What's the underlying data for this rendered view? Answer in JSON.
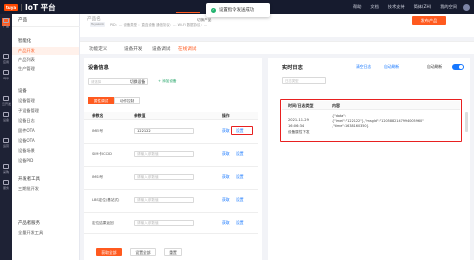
{
  "topbar": {
    "logo_text": "tuya",
    "title": "IoT 平台",
    "links": [
      "帮助",
      "文档",
      "技术支持",
      "简体(ZH)",
      "我的空间"
    ]
  },
  "toast": {
    "text": "设置指令发送成功"
  },
  "sidebar_icons": [
    {
      "label": "产品",
      "active": true
    },
    {
      "label": "应用"
    },
    {
      "label": "App"
    },
    {
      "label": "云开发"
    },
    {
      "label": "设备"
    },
    {
      "label": "运营"
    },
    {
      "label": "采购"
    },
    {
      "label": "服务"
    }
  ],
  "sidebar": {
    "header": "产品",
    "sections": [
      {
        "title": "智能化",
        "items": [
          "产品开发",
          "产品列表",
          "生产管理"
        ]
      },
      {
        "title": "设备",
        "items": [
          "设备管理",
          "子设备管理",
          "设备日志",
          "固件OTA",
          "设备OTA",
          "设备场景",
          "设备PID"
        ]
      },
      {
        "title": "开发者工具",
        "items": [
          "三期批开发"
        ]
      },
      {
        "title": "产品者服务",
        "items": [
          "全量开发工具"
        ]
      }
    ],
    "active_item": "产品开发"
  },
  "product_header": {
    "product_name": "产品名",
    "switch_label": "切换产品",
    "back_label": "TuyaLink",
    "meta": "PID：… 设备类型 ：直连设备   通信协议：…   Wi-Fi 数据协议：…",
    "publish_button": "发布产品"
  },
  "tabs": [
    "功能定义",
    "设备开发",
    "设备调试",
    "在线调试"
  ],
  "active_tab": "在线调试",
  "device_panel": {
    "title": "设备信息",
    "select_placeholder": "请选择",
    "switch_device": "切换设备",
    "add_device": "+ 添加设备",
    "subtabs": [
      "属性调试",
      "动作控制"
    ],
    "columns": [
      "参数名",
      "参数值",
      "操作"
    ],
    "rows": [
      {
        "name": "IMEI号",
        "value": "122122",
        "placeholder": false
      },
      {
        "name": "SIM卡ICCID",
        "value": "请输入参数值",
        "placeholder": true
      },
      {
        "name": "IMSI号",
        "value": "请输入参数值",
        "placeholder": true
      },
      {
        "name": "LBS定位(基站式)",
        "value": "请输入参数值",
        "placeholder": true
      },
      {
        "name": "定位结果返回",
        "value": "请输入参数值",
        "placeholder": true
      }
    ],
    "get_label": "获取",
    "set_label": "设置",
    "bottom_buttons": [
      "获取全部",
      "设置全部",
      "重置"
    ]
  },
  "log_panel": {
    "title": "实时日志",
    "actions": [
      "清空日志",
      "自动刷新"
    ],
    "auto_refresh_label": "自动刷新",
    "auto_refresh_on": true,
    "filter_placeholder": "日志类型",
    "columns": [
      "时间/日志类型",
      "内容"
    ],
    "entries": [
      {
        "date": "2021-11-29",
        "time": "16:06:34",
        "type": "设备属性下发",
        "content": "{\"data\":\n{\"imei\":\"122122\"},\"msgId\":\"1205882147994005960\",\"time\":1638160350}"
      }
    ]
  },
  "colors": {
    "accent": "#ff5a1f",
    "link": "#1677ff",
    "highlight": "#e82020",
    "success": "#21b26e"
  }
}
